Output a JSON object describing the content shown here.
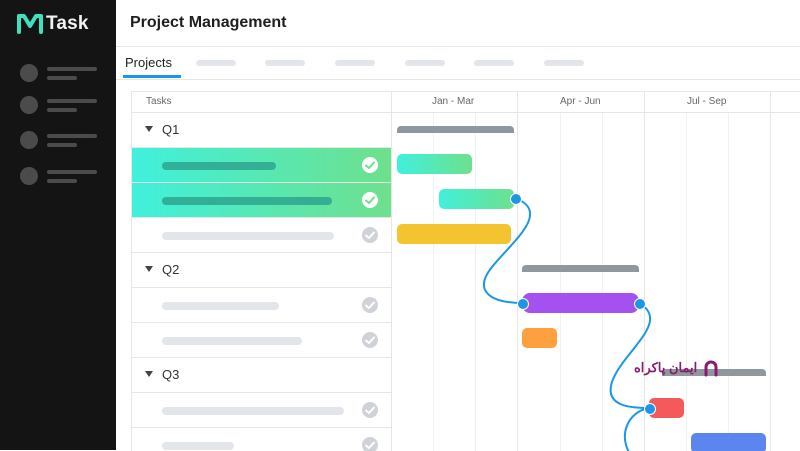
{
  "app": {
    "name": "Task",
    "colors": {
      "sidebar": "#141414",
      "accent": "#1b97e6",
      "logo": "#3ee0c0"
    }
  },
  "header": {
    "title": "Project Management"
  },
  "tabs": {
    "active": "Projects"
  },
  "gantt": {
    "tasks_header": "Tasks",
    "periods": [
      "Jan - Mar",
      "Apr - Jun",
      "Jul - Sep"
    ],
    "groups": [
      {
        "label": "Q1"
      },
      {
        "label": "Q2"
      },
      {
        "label": "Q3"
      }
    ],
    "completed_rows": 2
  },
  "watermark": {
    "text": "ایمان پاکراه"
  }
}
